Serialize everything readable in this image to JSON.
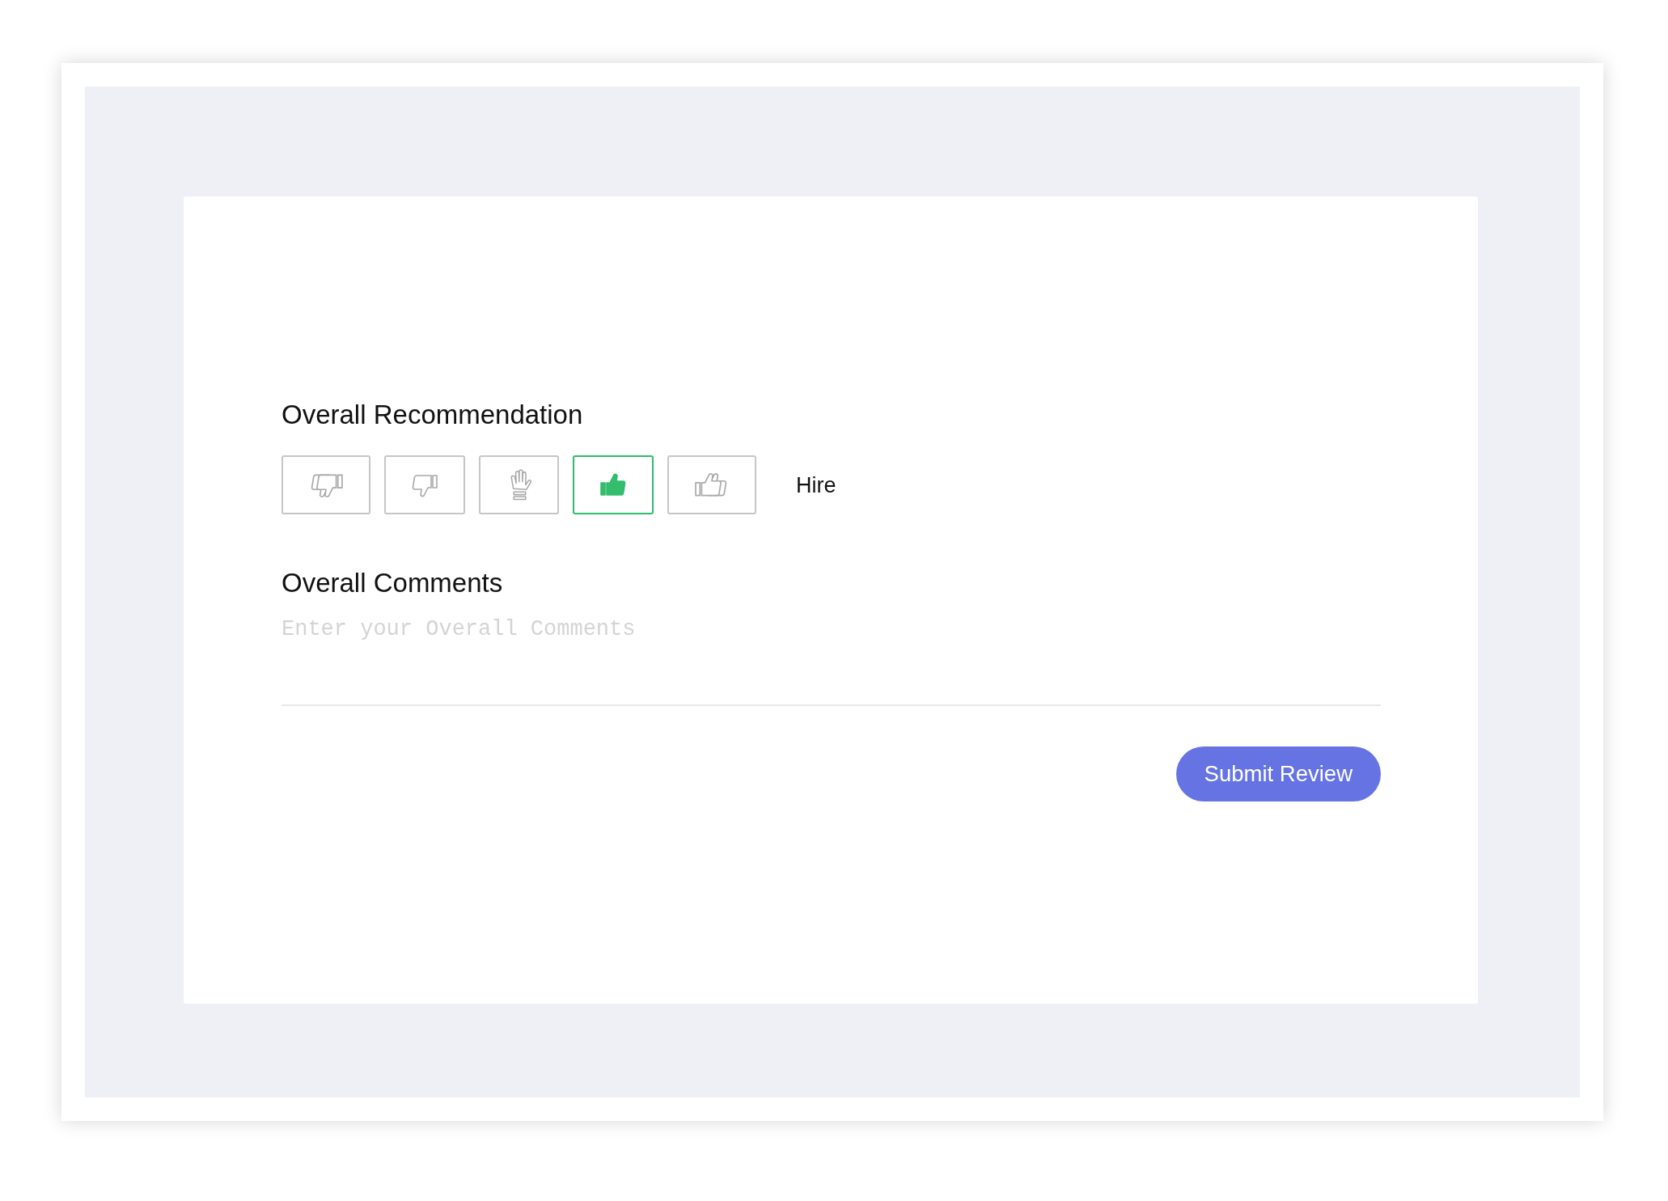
{
  "recommendation": {
    "title": "Overall Recommendation",
    "options": [
      {
        "kind": "strong_no",
        "selected": false
      },
      {
        "kind": "no",
        "selected": false
      },
      {
        "kind": "neutral",
        "selected": false
      },
      {
        "kind": "yes",
        "selected": true
      },
      {
        "kind": "strong_yes",
        "selected": false
      }
    ],
    "selected_label": "Hire"
  },
  "comments": {
    "title": "Overall Comments",
    "placeholder": "Enter your Overall Comments"
  },
  "submit_button": {
    "label": "Submit Review"
  }
}
